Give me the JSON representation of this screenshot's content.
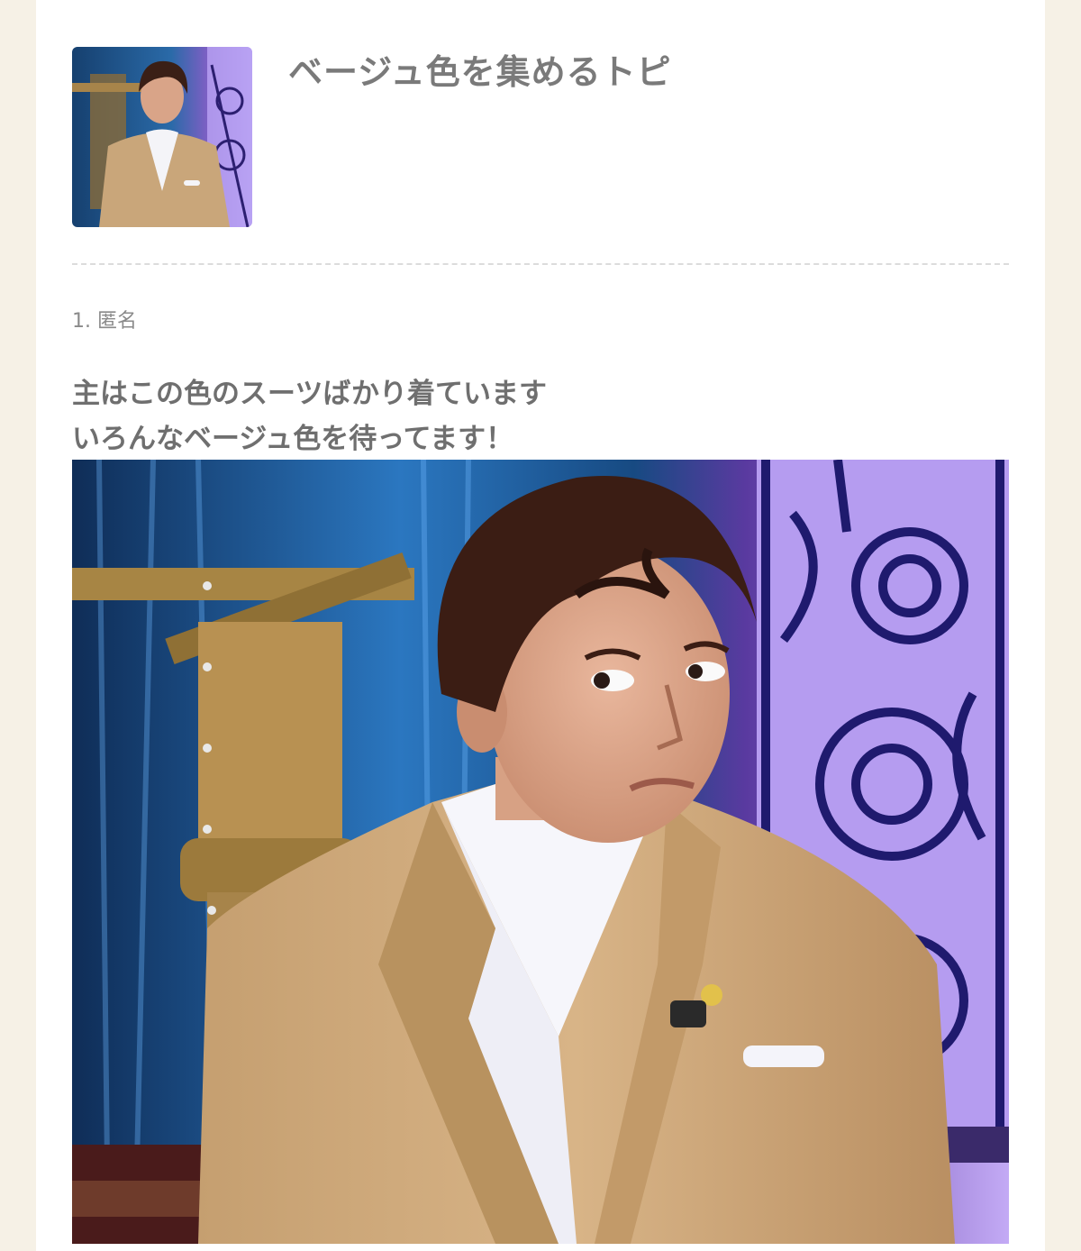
{
  "topic": {
    "title": "ベージュ色を集めるトピ",
    "thumbnail_alt": "beige-suit-photo-thumbnail"
  },
  "comment": {
    "number_label": "1. 匿名",
    "lines": [
      "主はこの色のスーツばかり着ています",
      "いろんなベージュ色を待ってます！"
    ],
    "photo_alt": "man-in-beige-suit-photo"
  },
  "colors": {
    "page_background": "#f6f1e6",
    "card_background": "#ffffff",
    "title_text": "#7a7a7a",
    "meta_text": "#8a8a8a",
    "body_text": "#6f6f6f",
    "suit_beige": "#c9a67a",
    "backdrop_blue": "#1d4e86",
    "backdrop_purple": "#b59cf0"
  }
}
